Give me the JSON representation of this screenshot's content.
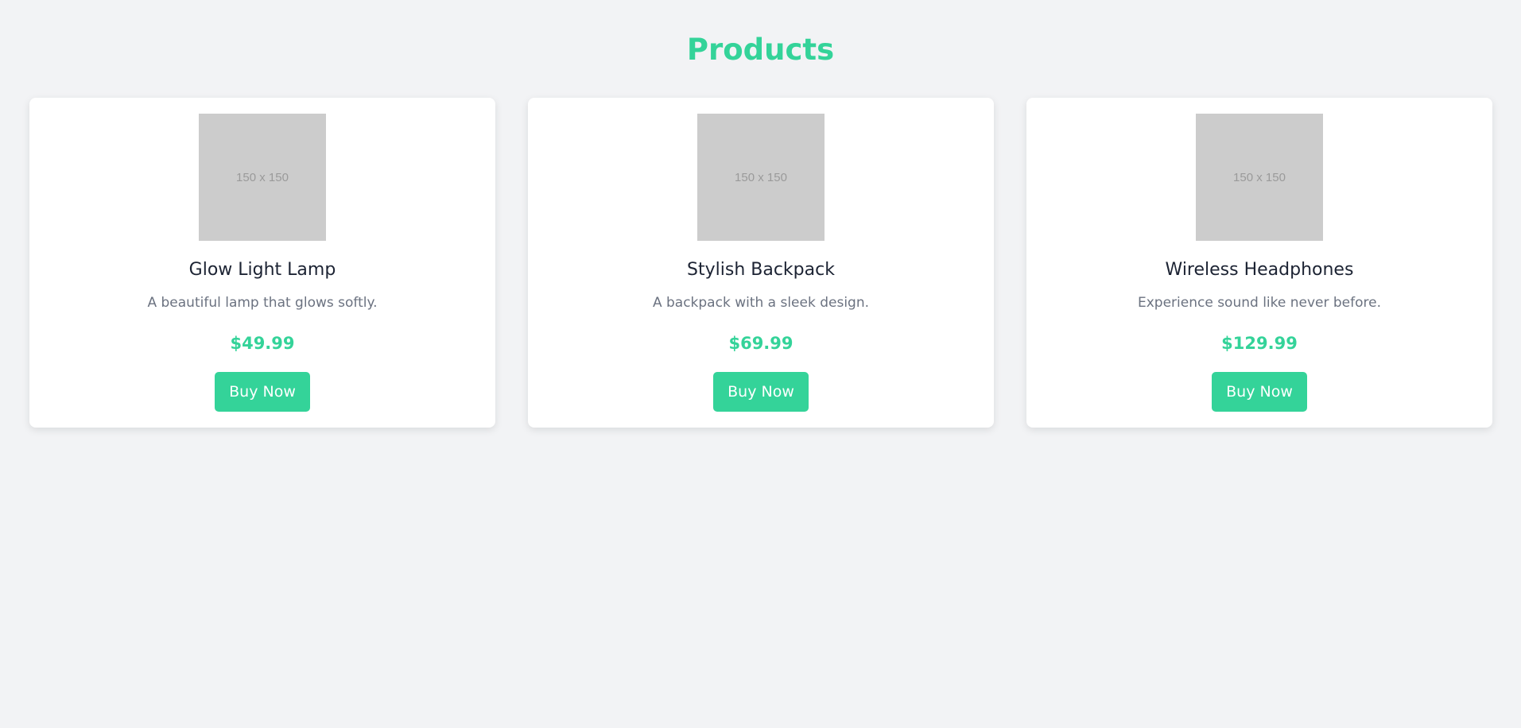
{
  "page": {
    "title": "Products"
  },
  "colors": {
    "accent": "#34d399",
    "background": "#f2f3f5",
    "card": "#ffffff",
    "name_text": "#1c2333",
    "desc_text": "#6b7280",
    "placeholder": "#cccccc"
  },
  "products": [
    {
      "image_label": "150 x 150",
      "name": "Glow Light Lamp",
      "description": "A beautiful lamp that glows softly.",
      "price": "$49.99",
      "button_label": "Buy Now"
    },
    {
      "image_label": "150 x 150",
      "name": "Stylish Backpack",
      "description": "A backpack with a sleek design.",
      "price": "$69.99",
      "button_label": "Buy Now"
    },
    {
      "image_label": "150 x 150",
      "name": "Wireless Headphones",
      "description": "Experience sound like never before.",
      "price": "$129.99",
      "button_label": "Buy Now"
    }
  ]
}
